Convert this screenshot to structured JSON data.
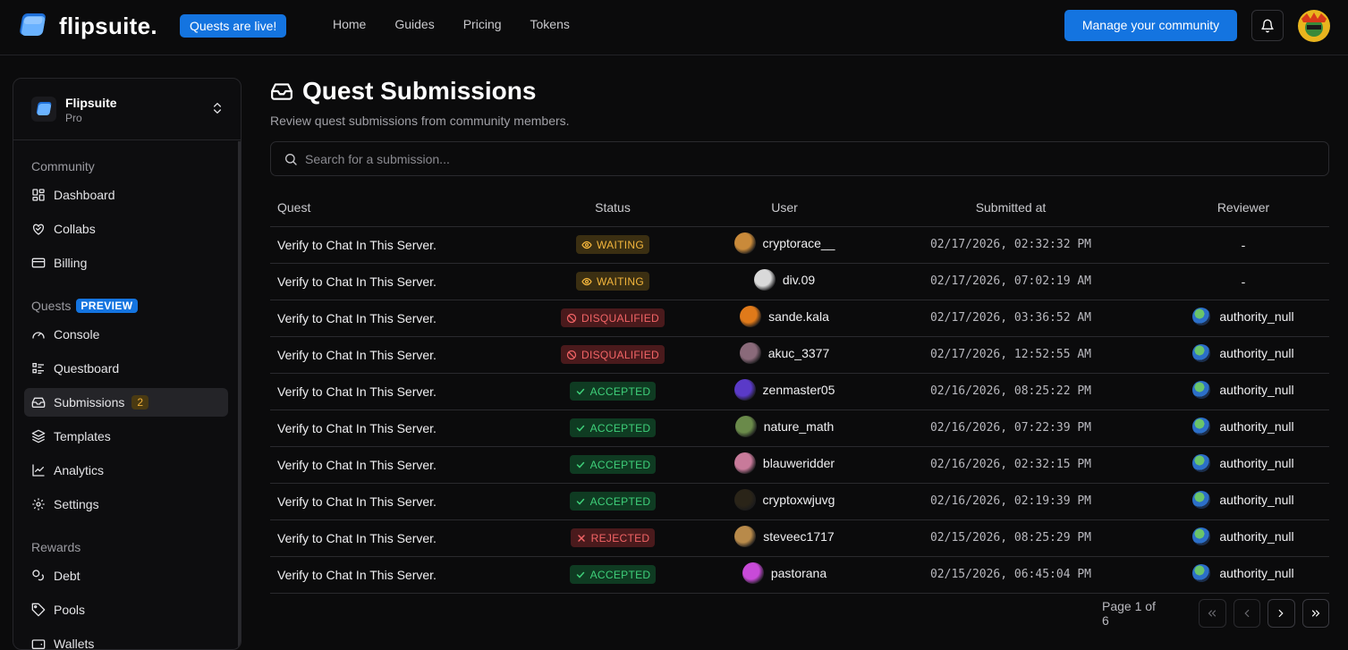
{
  "brand": {
    "name": "flipsuite.",
    "badge": "Quests are live!"
  },
  "topnav": [
    "Home",
    "Guides",
    "Pricing",
    "Tokens"
  ],
  "header": {
    "manage_label": "Manage your community"
  },
  "org": {
    "name": "Flipsuite",
    "plan": "Pro"
  },
  "sidebar": {
    "community_title": "Community",
    "community_items": [
      {
        "label": "Dashboard",
        "icon": "dashboard-icon"
      },
      {
        "label": "Collabs",
        "icon": "handshake-icon"
      },
      {
        "label": "Billing",
        "icon": "credit-card-icon"
      }
    ],
    "quests_title": "Quests",
    "quests_badge": "PREVIEW",
    "quests_items": [
      {
        "label": "Console",
        "icon": "gauge-icon"
      },
      {
        "label": "Questboard",
        "icon": "list-icon"
      },
      {
        "label": "Submissions",
        "icon": "inbox-icon",
        "count": "2",
        "active": true
      },
      {
        "label": "Templates",
        "icon": "layers-icon"
      },
      {
        "label": "Analytics",
        "icon": "chart-line-icon"
      },
      {
        "label": "Settings",
        "icon": "gear-icon"
      }
    ],
    "rewards_title": "Rewards",
    "rewards_items": [
      {
        "label": "Debt",
        "icon": "coins-icon"
      },
      {
        "label": "Pools",
        "icon": "tag-icon"
      },
      {
        "label": "Wallets",
        "icon": "wallet-icon"
      }
    ]
  },
  "page": {
    "title": "Quest Submissions",
    "subtitle": "Review quest submissions from community members.",
    "search_placeholder": "Search for a submission..."
  },
  "table": {
    "headers": [
      "Quest",
      "Status",
      "User",
      "Submitted at",
      "Reviewer"
    ],
    "rows": [
      {
        "quest": "Verify to Chat In This Server.",
        "status": "WAITING",
        "status_type": "waiting",
        "user": "cryptorace__",
        "avatar_color": "#c98a3a",
        "submitted": "02/17/2026, 02:32:32 PM",
        "reviewer": "-"
      },
      {
        "quest": "Verify to Chat In This Server.",
        "status": "WAITING",
        "status_type": "waiting",
        "user": "div.09",
        "avatar_color": "#d9d9d9",
        "submitted": "02/17/2026, 07:02:19 AM",
        "reviewer": "-"
      },
      {
        "quest": "Verify to Chat In This Server.",
        "status": "DISQUALIFIED",
        "status_type": "disqualified",
        "user": "sande.kala",
        "avatar_color": "#e07a1a",
        "submitted": "02/17/2026, 03:36:52 AM",
        "reviewer": "authority_null"
      },
      {
        "quest": "Verify to Chat In This Server.",
        "status": "DISQUALIFIED",
        "status_type": "disqualified",
        "user": "akuc_3377",
        "avatar_color": "#8a6a7a",
        "submitted": "02/17/2026, 12:52:55 AM",
        "reviewer": "authority_null"
      },
      {
        "quest": "Verify to Chat In This Server.",
        "status": "ACCEPTED",
        "status_type": "accepted",
        "user": "zenmaster05",
        "avatar_color": "#5a3ac8",
        "submitted": "02/16/2026, 08:25:22 PM",
        "reviewer": "authority_null"
      },
      {
        "quest": "Verify to Chat In This Server.",
        "status": "ACCEPTED",
        "status_type": "accepted",
        "user": "nature_math",
        "avatar_color": "#6a8a4a",
        "submitted": "02/16/2026, 07:22:39 PM",
        "reviewer": "authority_null"
      },
      {
        "quest": "Verify to Chat In This Server.",
        "status": "ACCEPTED",
        "status_type": "accepted",
        "user": "blauweridder",
        "avatar_color": "#c87a9a",
        "submitted": "02/16/2026, 02:32:15 PM",
        "reviewer": "authority_null"
      },
      {
        "quest": "Verify to Chat In This Server.",
        "status": "ACCEPTED",
        "status_type": "accepted",
        "user": "cryptoxwjuvg",
        "avatar_color": "#2a2418",
        "submitted": "02/16/2026, 02:19:39 PM",
        "reviewer": "authority_null"
      },
      {
        "quest": "Verify to Chat In This Server.",
        "status": "REJECTED",
        "status_type": "rejected",
        "user": "steveec1717",
        "avatar_color": "#b88a4a",
        "submitted": "02/15/2026, 08:25:29 PM",
        "reviewer": "authority_null"
      },
      {
        "quest": "Verify to Chat In This Server.",
        "status": "ACCEPTED",
        "status_type": "accepted",
        "user": "pastorana",
        "avatar_color": "#c84ad8",
        "submitted": "02/15/2026, 06:45:04 PM",
        "reviewer": "authority_null"
      }
    ]
  },
  "pagination": {
    "label": "Page 1 of 6"
  },
  "colors": {
    "accent": "#1474e0",
    "waiting": "#f3b53c",
    "accepted": "#3fd07a",
    "danger": "#f26466"
  }
}
